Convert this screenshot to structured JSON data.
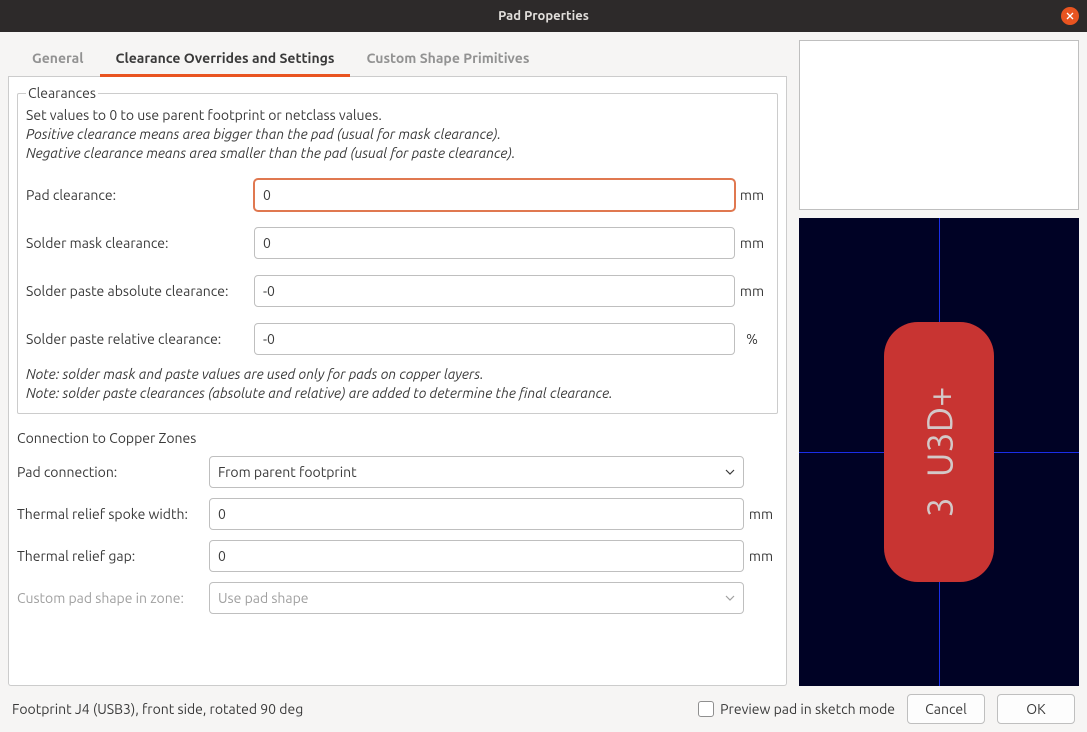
{
  "title": "Pad Properties",
  "tabs": {
    "general": "General",
    "clearance": "Clearance Overrides and Settings",
    "custom": "Custom Shape Primitives"
  },
  "clearances": {
    "legend": "Clearances",
    "intro": "Set values to 0 to use parent footprint or netclass values.",
    "positive_note": "Positive clearance means area bigger than the pad (usual for mask clearance).",
    "negative_note": "Negative clearance means area smaller than the pad (usual for paste clearance).",
    "pad_clearance_label": "Pad clearance:",
    "pad_clearance_value": "0",
    "solder_mask_label": "Solder mask clearance:",
    "solder_mask_value": "0",
    "solder_paste_abs_label": "Solder paste absolute clearance:",
    "solder_paste_abs_value": "-0",
    "solder_paste_rel_label": "Solder paste relative clearance:",
    "solder_paste_rel_value": "-0",
    "note1": "Note: solder mask and paste values are used only for pads on copper layers.",
    "note2": "Note: solder paste clearances (absolute and relative) are added to determine the final clearance.",
    "unit_mm": "mm",
    "unit_percent": "%"
  },
  "copper": {
    "title": "Connection to Copper Zones",
    "pad_connection_label": "Pad connection:",
    "pad_connection_value": "From parent footprint",
    "spoke_width_label": "Thermal relief spoke width:",
    "spoke_width_value": "0",
    "relief_gap_label": "Thermal relief gap:",
    "relief_gap_value": "0",
    "custom_shape_label": "Custom pad shape in zone:",
    "custom_shape_value": "Use pad shape",
    "unit_mm": "mm"
  },
  "preview": {
    "pad_number": "3",
    "net_name": "U3D+"
  },
  "bottom": {
    "status": "Footprint J4 (USB3), front side, rotated 90 deg",
    "sketch_checkbox_label": "Preview pad in sketch mode",
    "cancel": "Cancel",
    "ok": "OK"
  }
}
